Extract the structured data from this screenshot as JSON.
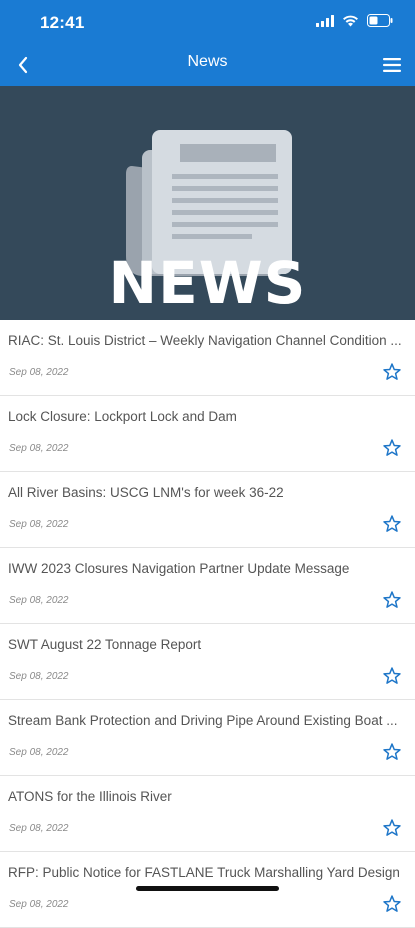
{
  "status_bar": {
    "time": "12:41"
  },
  "nav": {
    "title": "News"
  },
  "hero": {
    "label": "NEWS"
  },
  "colors": {
    "nav_blue": "#1a7bd3",
    "hero_bg": "#34495a",
    "star_blue": "#1e76c8"
  },
  "articles": [
    {
      "title": "RIAC: St. Louis District – Weekly Navigation Channel Condition ...",
      "date": "Sep 08, 2022"
    },
    {
      "title": "Lock Closure: Lockport Lock and Dam",
      "date": "Sep 08, 2022"
    },
    {
      "title": "All River Basins: USCG LNM's for week 36-22",
      "date": "Sep 08, 2022"
    },
    {
      "title": "IWW 2023 Closures Navigation Partner Update Message",
      "date": "Sep 08, 2022"
    },
    {
      "title": "SWT August 22 Tonnage Report",
      "date": "Sep 08, 2022"
    },
    {
      "title": "Stream Bank Protection and Driving Pipe Around Existing Boat ...",
      "date": "Sep 08, 2022"
    },
    {
      "title": "ATONS for the Illinois River",
      "date": "Sep 08, 2022"
    },
    {
      "title": "RFP: Public Notice for FASTLANE Truck Marshalling Yard Design",
      "date": "Sep 08, 2022"
    }
  ]
}
